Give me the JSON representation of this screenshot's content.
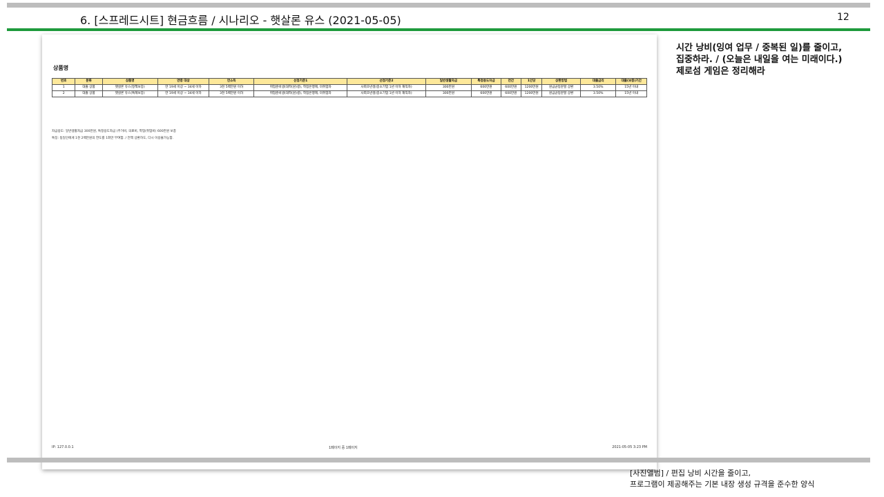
{
  "slide": {
    "title": "6. [스프레드시트] 현금흐름 / 시나리오 - 햇살론 유스 (2021-05-05)",
    "page_number": "12"
  },
  "document": {
    "heading": "상품명",
    "table": {
      "headers": [
        "번호",
        "분류",
        "상품명",
        "연령 대상",
        "연소득",
        "선정기준1",
        "선정기준2",
        "일반생활자금",
        "특정용도자금",
        "연간",
        "1인당",
        "상환방법",
        "대출금리",
        "대출(보증)기간"
      ],
      "rows": [
        [
          "1",
          "대출 상품",
          "햇살론 유스(정책보증)",
          "만 19세 이상 ~ 34세 이하",
          "3천 5백만원 이하",
          "취업준비생(대학(원)생), 학점은행제, 미취업자",
          "사회초년생(중소기업 1년 이하 재직자)",
          "300만원",
          "600만원",
          "600만원",
          "1200만원",
          "원금균등분할 상환",
          "3.50%",
          "15년 이내"
        ],
        [
          "2",
          "대출 상품",
          "햇살론 유스(특례보증)",
          "만 19세 이상 ~ 34세 이하",
          "3천 5백만원 이하",
          "취업준비생(대학(원)생), 학점은행제, 미취업자",
          "사회초년생(중소기업 1년 이하 재직자)",
          "300만원",
          "600만원",
          "600만원",
          "1200만원",
          "원금균등분할 상환",
          "3.50%",
          "15년 이내"
        ]
      ]
    },
    "notes": [
      "자금용도: 일반생활자금 300만원, 특정용도자금 (주거비, 의료비, 학업(취업비) 600만원 보충",
      "특징: 동일인에게 1천 2백만원의 한도를 1회만 부여함. / 전액 상환하도, 다시 이용불가능함."
    ],
    "footer": {
      "left": "IP: 127.0.0.1",
      "center": "1페이지 중 1페이지",
      "right": "2021-05-05 3:23 PM"
    }
  },
  "side_note": {
    "lines": [
      "시간 낭비(잉여 업무 / 중복된 일)를 줄이고,",
      "집중하라. / (오늘은 내일을 여는 미래이다.)",
      "제로섬 게임은 정리해라"
    ]
  },
  "caption": {
    "lines": [
      "[사진앨범] / 편집 낭비 시간을 줄이고,",
      "프로그램이 제공해주는 기본 내장 생성 규격을 준수한 양식"
    ]
  }
}
